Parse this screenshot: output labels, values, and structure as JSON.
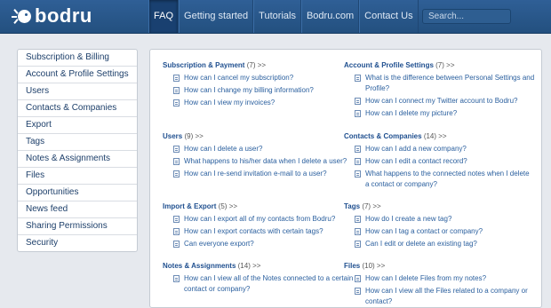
{
  "brand": {
    "name": "bodru"
  },
  "nav": {
    "items": [
      "FAQ",
      "Getting started",
      "Tutorials",
      "Bodru.com",
      "Contact Us"
    ]
  },
  "search": {
    "placeholder": "Search..."
  },
  "sidebar": {
    "items": [
      "Subscription & Billing",
      "Account & Profile Settings",
      "Users",
      "Contacts & Companies",
      "Export",
      "Tags",
      "Notes & Assignments",
      "Files",
      "Opportunities",
      "News feed",
      "Sharing Permissions",
      "Security"
    ]
  },
  "sections": [
    {
      "title": "Subscription & Payment",
      "count": "(7) >>",
      "questions": [
        "How can I cancel my subscription?",
        "How can I change my billing information?",
        "How can I view my invoices?"
      ]
    },
    {
      "title": "Account & Profile Settings",
      "count": "(7) >>",
      "questions": [
        "What is the difference between Personal Settings and Profile?",
        "How can I connect my Twitter account to Bodru?",
        "How can I delete my picture?"
      ]
    },
    {
      "title": "Users",
      "count": "(9) >>",
      "questions": [
        "How can I delete a user?",
        "What happens to his/her data when I delete a user?",
        "How can I re-send invitation e-mail to a user?"
      ]
    },
    {
      "title": "Contacts & Companies",
      "count": "(14) >>",
      "questions": [
        "How can I add a new company?",
        "How can I edit a contact record?",
        "What happens to the connected notes when I delete a contact or company?"
      ]
    },
    {
      "title": "Import & Export",
      "count": "(5) >>",
      "questions": [
        "How can I export all of my contacts from Bodru?",
        "How can I export contacts with certain tags?",
        "Can everyone export?"
      ]
    },
    {
      "title": "Tags",
      "count": "(7) >>",
      "questions": [
        "How do I create a new tag?",
        "How can I tag a contact or company?",
        "Can I edit or delete an existing tag?"
      ]
    },
    {
      "title": "Notes & Assignments",
      "count": "(14) >>",
      "questions": [
        "How can I view all of the Notes connected to a certain contact or company?"
      ]
    },
    {
      "title": "Files",
      "count": "(10) >>",
      "questions": [
        "How can I delete Files from my notes?",
        "How can I view all the Files related to a company or contact?"
      ]
    }
  ],
  "colors": {
    "header": "#2a5a8f",
    "link": "#2a5f9e",
    "background": "#e6e9ee"
  }
}
